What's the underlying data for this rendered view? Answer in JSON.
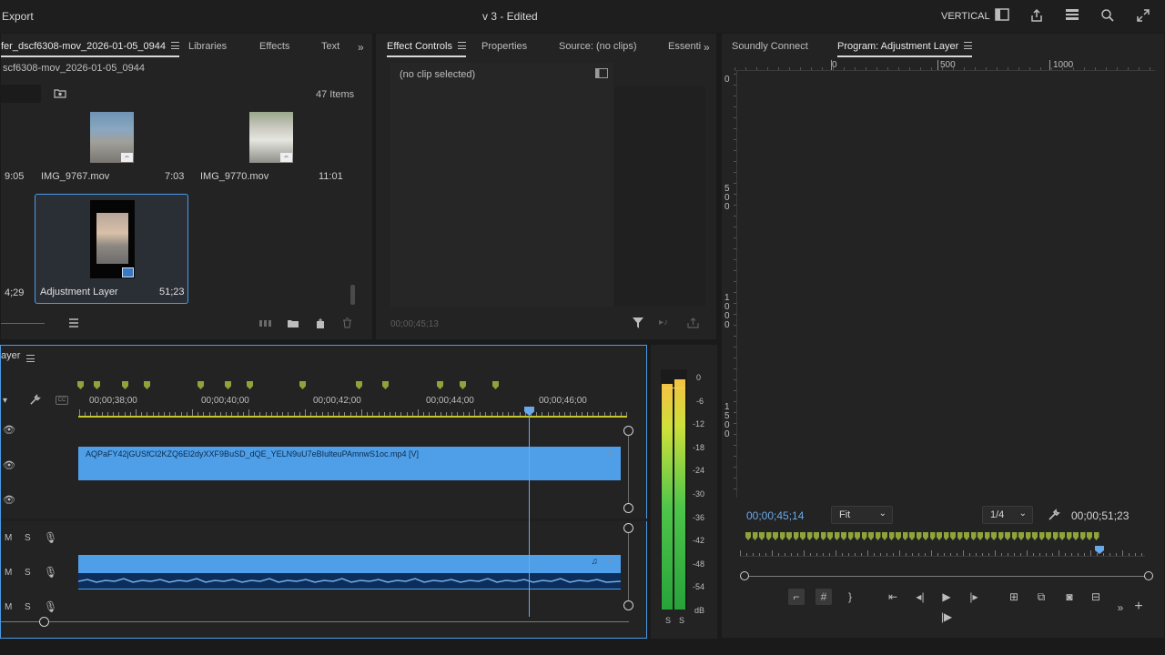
{
  "topbar": {
    "export_label": "Export",
    "doc_title": "v 3 - Edited",
    "workspace_label": "VERTICAL"
  },
  "project_panel": {
    "tabs": [
      {
        "label": "fer_dscf6308-mov_2026-01-05_0944"
      },
      {
        "label": "Libraries"
      },
      {
        "label": "Effects"
      },
      {
        "label": "Text"
      }
    ],
    "bin_path": "scf6308-mov_2026-01-05_0944",
    "item_count": "47 Items",
    "items": [
      {
        "name": "",
        "duration": "9:05"
      },
      {
        "name": "IMG_9767.mov",
        "duration": "7:03"
      },
      {
        "name": "IMG_9770.mov",
        "duration": "11:01"
      },
      {
        "name": "",
        "duration": "4;29"
      },
      {
        "name": "Adjustment Layer",
        "duration": "51;23"
      }
    ]
  },
  "effect_controls": {
    "tabs": [
      {
        "label": "Effect Controls"
      },
      {
        "label": "Properties"
      },
      {
        "label": "Source: (no clips)"
      },
      {
        "label": "Essenti"
      }
    ],
    "no_clip_text": "(no clip selected)",
    "timecode": "00;00;45;13"
  },
  "program_monitor": {
    "tabs": [
      {
        "label": "Soundly Connect"
      },
      {
        "label": "Program: Adjustment Layer"
      }
    ],
    "ruler_h": [
      "0",
      "500",
      "1000"
    ],
    "ruler_v": [
      "0",
      "500",
      "1000",
      "1500"
    ],
    "current_timecode": "00;00;45;14",
    "fit_label": "Fit",
    "resolution_label": "1/4",
    "duration_timecode": "00;00;51;23"
  },
  "timeline": {
    "title": "ayer",
    "ruler_labels": [
      "00;00;38;00",
      "00;00;40;00",
      "00;00;42;00",
      "00;00;44;00",
      "00;00;46;00"
    ],
    "video_clip_name": "AQPaFY42jGUSfCI2KZQ6El2dyXXF9BuSD_dQE_YELN9uU7eBIulteuPAmnwS1oc.mp4 [V]",
    "track_labels": {
      "m": "M",
      "s": "S"
    }
  },
  "audio_meter": {
    "scale": [
      "0",
      "-6",
      "-12",
      "-18",
      "-24",
      "-30",
      "-36",
      "-42",
      "-48",
      "-54",
      "dB"
    ],
    "solo_labels": [
      "S",
      "S"
    ],
    "levels": [
      0.94,
      0.96
    ]
  },
  "colors": {
    "accent_blue": "#4a9be6",
    "clip_blue": "#4f9fe8",
    "marker_green": "#8fa33a",
    "playhead_blue": "#6aa9e9"
  }
}
